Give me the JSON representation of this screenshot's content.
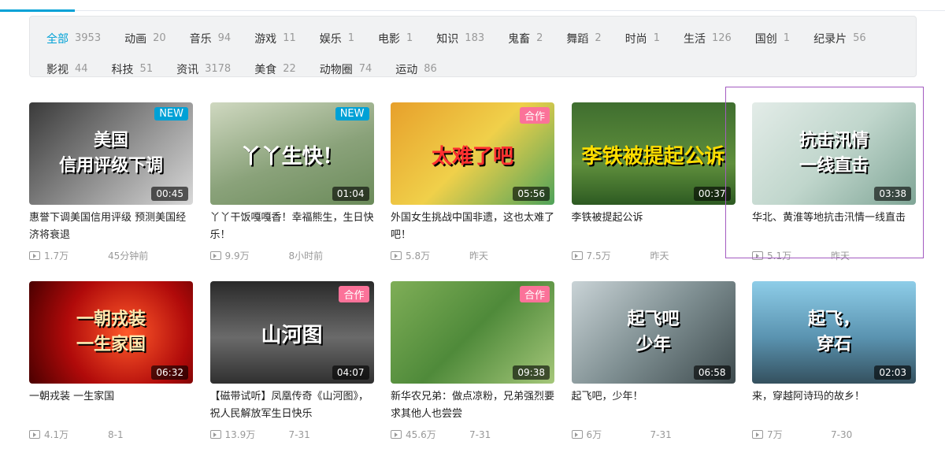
{
  "filters": [
    [
      {
        "name": "全部",
        "count": "3953",
        "active": true
      },
      {
        "name": "动画",
        "count": "20"
      },
      {
        "name": "音乐",
        "count": "94"
      },
      {
        "name": "游戏",
        "count": "11"
      },
      {
        "name": "娱乐",
        "count": "1"
      },
      {
        "name": "电影",
        "count": "1"
      },
      {
        "name": "知识",
        "count": "183"
      },
      {
        "name": "鬼畜",
        "count": "2"
      },
      {
        "name": "舞蹈",
        "count": "2"
      },
      {
        "name": "时尚",
        "count": "1"
      },
      {
        "name": "生活",
        "count": "126"
      },
      {
        "name": "国创",
        "count": "1"
      },
      {
        "name": "纪录片",
        "count": "56"
      }
    ],
    [
      {
        "name": "影视",
        "count": "44"
      },
      {
        "name": "科技",
        "count": "51"
      },
      {
        "name": "资讯",
        "count": "3178"
      },
      {
        "name": "美食",
        "count": "22"
      },
      {
        "name": "动物圈",
        "count": "74"
      },
      {
        "name": "运动",
        "count": "86"
      }
    ]
  ],
  "videos": [
    {
      "title": "惠誉下调美国信用评级 预测美国经济将衰退",
      "views": "1.7万",
      "time": "45分钟前",
      "duration": "00:45",
      "badge": "NEW",
      "badge_type": "new",
      "thumb_text": "美国\n信用评级下调",
      "bg": "linear-gradient(135deg,#3a3a3a,#9a9a9a 60%,#d8d8d8)",
      "text_color": "#ffffff"
    },
    {
      "title": "丫丫干饭嘎嘎香！幸福熊生，生日快乐！",
      "views": "9.9万",
      "time": "8小时前",
      "duration": "01:04",
      "badge": "NEW",
      "badge_type": "new",
      "thumb_text": "丫丫生快！",
      "bg": "linear-gradient(160deg,#cfd8c0,#8aa27a 55%,#6b8b5a)",
      "text_color": "#ffffff"
    },
    {
      "title": "外国女生挑战中国非遗，这也太难了吧！",
      "views": "5.8万",
      "time": "昨天",
      "duration": "05:56",
      "badge": "合作",
      "badge_type": "coop",
      "thumb_text": "太难了吧",
      "bg": "linear-gradient(135deg,#e7a02b,#f0d04a 50%,#4fa35a)",
      "text_color": "#ff3030"
    },
    {
      "title": "李铁被提起公诉",
      "views": "7.5万",
      "time": "昨天",
      "duration": "00:37",
      "badge": "",
      "badge_type": "",
      "thumb_text": "李铁被提起公诉",
      "bg": "linear-gradient(180deg,#3f6e2f,#5f8f3c 60%,#2d5a22)",
      "text_color": "#ffdd00"
    },
    {
      "title": "华北、黄淮等地抗击汛情一线直击",
      "views": "5.1万",
      "time": "昨天",
      "duration": "03:38",
      "badge": "",
      "badge_type": "",
      "thumb_text": "抗击汛情\n一线直击",
      "bg": "linear-gradient(135deg,#e3ece8,#c0d6cc 50%,#7fa596)",
      "text_color": "#ffffff"
    },
    {
      "title": "一朝戎装 一生家国",
      "views": "4.1万",
      "time": "8-1",
      "duration": "06:32",
      "badge": "",
      "badge_type": "",
      "thumb_text": "一朝戎装\n一生家国",
      "bg": "radial-gradient(circle at 60% 50%,#ff5a2a,#b00a0a 55%,#4a0000)",
      "text_color": "#ffe9b0"
    },
    {
      "title": "【磁带试听】凤凰传奇《山河图》，祝人民解放军生日快乐",
      "views": "13.9万",
      "time": "7-31",
      "duration": "04:07",
      "badge": "合作",
      "badge_type": "coop",
      "thumb_text": "山河图",
      "bg": "linear-gradient(180deg,#2a2a2a,#6a6a6a 55%,#303030)",
      "text_color": "#ffffff"
    },
    {
      "title": "新华农兄弟：做点凉粉，兄弟强烈要求其他人也尝尝",
      "views": "45.6万",
      "time": "7-31",
      "duration": "09:38",
      "badge": "合作",
      "badge_type": "coop",
      "thumb_text": "",
      "bg": "linear-gradient(135deg,#7fae57,#4f8a3a 50%,#a5c77a)",
      "text_color": "#ffffff"
    },
    {
      "title": "起飞吧，少年！",
      "views": "6万",
      "time": "7-31",
      "duration": "06:58",
      "badge": "",
      "badge_type": "",
      "thumb_text": "起飞吧\n少年",
      "bg": "linear-gradient(135deg,#c9d3d6,#7f8f92 50%,#3d4a4d)",
      "text_color": "#ffffff"
    },
    {
      "title": "来，穿越阿诗玛的故乡！",
      "views": "7万",
      "time": "7-30",
      "duration": "02:03",
      "badge": "",
      "badge_type": "",
      "thumb_text": "起飞，\n穿石",
      "bg": "linear-gradient(180deg,#8ecde8,#5a93b0 55%,#34505e)",
      "text_color": "#ffffff"
    }
  ]
}
